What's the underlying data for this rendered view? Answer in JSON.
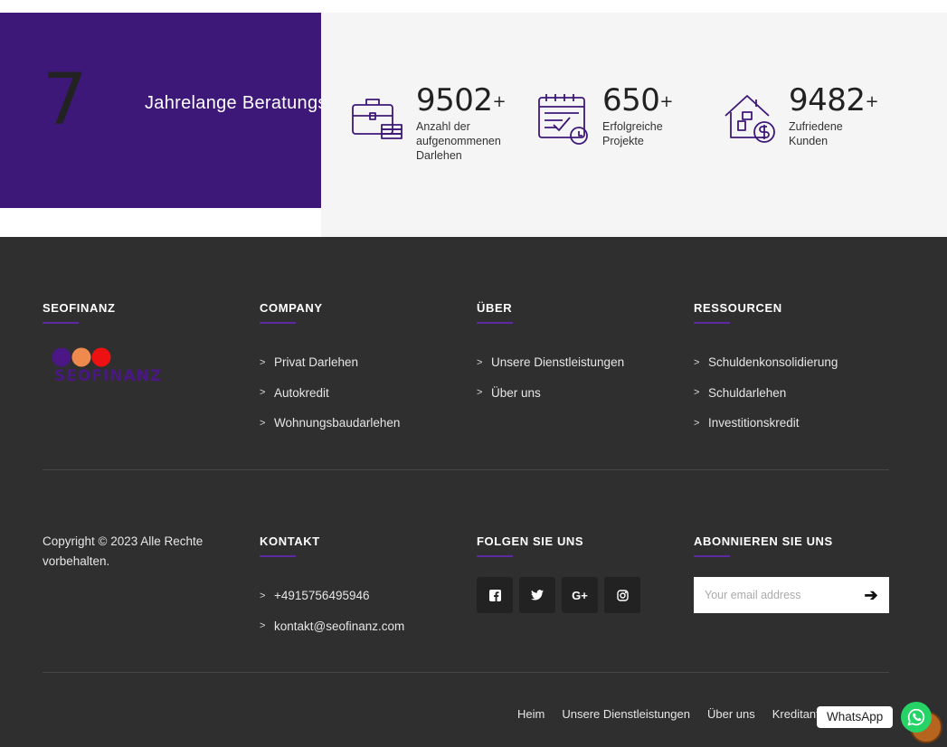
{
  "experience": {
    "number": "7",
    "text": "Jahrelange Beratungserfahrung"
  },
  "stats": [
    {
      "icon": "briefcase-money-icon",
      "number": "9502",
      "plus": "+",
      "label": "Anzahl der aufgenommenen Darlehen"
    },
    {
      "icon": "calendar-icon",
      "number": "650",
      "plus": "+",
      "label": "Erfolgreiche Projekte"
    },
    {
      "icon": "house-dollar-icon",
      "number": "9482",
      "plus": "+",
      "label": "Zufriedene Kunden"
    }
  ],
  "footer": {
    "brand_title": "SEOFINANZ",
    "logo_text": "SEOFINANZ",
    "company": {
      "title": "COMPANY",
      "links": [
        "Privat Darlehen",
        "Autokredit",
        "Wohnungsbaudarlehen"
      ]
    },
    "uber": {
      "title": "ÜBER",
      "links": [
        "Unsere Dienstleistungen",
        "Über uns"
      ]
    },
    "ressourcen": {
      "title": "RESSOURCEN",
      "links": [
        "Schuldenkonsolidierung",
        "Schuldarlehen",
        "Investitionskredit"
      ]
    },
    "copyright": "Copyright © 2023 Alle Rechte vorbehalten.",
    "kontakt": {
      "title": "KONTAKT",
      "phone": "+4915756495946",
      "email": "kontakt@seofinanz.com"
    },
    "follow": {
      "title": "FOLGEN SIE UNS",
      "icons": [
        "facebook-icon",
        "twitter-icon",
        "google-plus-icon",
        "instagram-icon"
      ],
      "glyphs": [
        "f",
        "t",
        "G+",
        "◎"
      ]
    },
    "subscribe": {
      "title": "ABONNIEREN SIE UNS",
      "placeholder": "Your email address",
      "button": "➔"
    },
    "bottom_nav": [
      "Heim",
      "Unsere Dienstleistungen",
      "Über uns",
      "Kreditantrag"
    ],
    "whatsapp_label": "WhatsApp"
  },
  "colors": {
    "accent_purple": "#3e1879",
    "footer_bg": "#2f2f2f",
    "stats_bg": "#f5f5f5",
    "whatsapp_green": "#25d366"
  }
}
